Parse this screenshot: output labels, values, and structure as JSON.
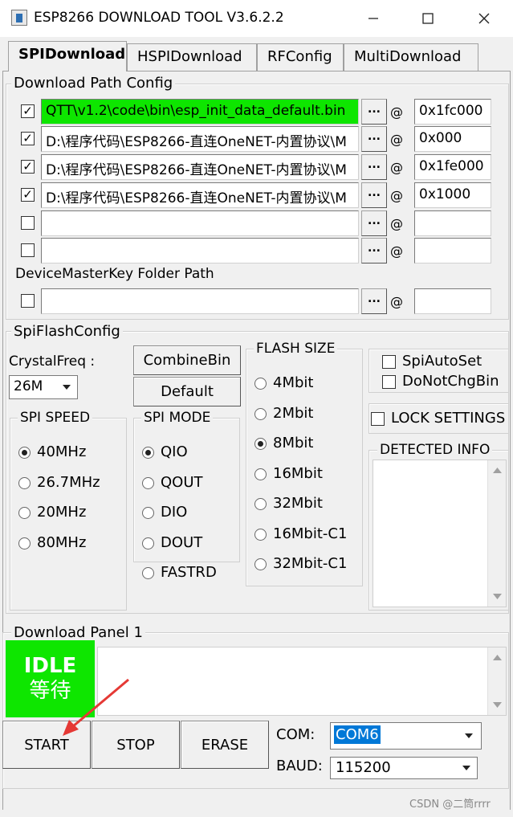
{
  "window": {
    "title": "ESP8266 DOWNLOAD TOOL V3.6.2.2",
    "minimize_icon": "minimize-icon",
    "maximize_icon": "maximize-icon",
    "close_icon": "close-icon"
  },
  "tabs": [
    {
      "label": "SPIDownload",
      "active": true
    },
    {
      "label": "HSPIDownload",
      "active": false
    },
    {
      "label": "RFConfig",
      "active": false
    },
    {
      "label": "MultiDownload",
      "active": false
    }
  ],
  "download_path_config": {
    "title": "Download Path Config",
    "browse_label": "...",
    "at_label": "@",
    "rows": [
      {
        "checked": true,
        "path": "QTT\\v1.2\\code\\bin\\esp_init_data_default.bin",
        "address": "0x1fc000",
        "highlight": "#0ee600"
      },
      {
        "checked": true,
        "path": "D:\\程序代码\\ESP8266-直连OneNET-内置协议\\M",
        "address": "0x000"
      },
      {
        "checked": true,
        "path": "D:\\程序代码\\ESP8266-直连OneNET-内置协议\\M",
        "address": "0x1fe000"
      },
      {
        "checked": true,
        "path": "D:\\程序代码\\ESP8266-直连OneNET-内置协议\\M",
        "address": "0x1000"
      },
      {
        "checked": false,
        "path": "",
        "address": ""
      },
      {
        "checked": false,
        "path": "",
        "address": ""
      }
    ],
    "device_master_key_label": "DeviceMasterKey Folder Path",
    "device_master_key_row": {
      "checked": false,
      "path": "",
      "address": ""
    }
  },
  "spi_flash_config": {
    "title": "SpiFlashConfig",
    "crystal_freq_label": "CrystalFreq :",
    "crystal_freq_value": "26M",
    "combine_bin_label": "CombineBin",
    "default_label": "Default",
    "spi_speed": {
      "title": "SPI SPEED",
      "options": [
        {
          "label": "40MHz",
          "selected": true
        },
        {
          "label": "26.7MHz",
          "selected": false
        },
        {
          "label": "20MHz",
          "selected": false
        },
        {
          "label": "80MHz",
          "selected": false
        }
      ]
    },
    "spi_mode": {
      "title": "SPI MODE",
      "options": [
        {
          "label": "QIO",
          "selected": true
        },
        {
          "label": "QOUT",
          "selected": false
        },
        {
          "label": "DIO",
          "selected": false
        },
        {
          "label": "DOUT",
          "selected": false
        },
        {
          "label": "FASTRD",
          "selected": false
        }
      ]
    },
    "flash_size": {
      "title": "FLASH SIZE",
      "options": [
        {
          "label": "4Mbit",
          "selected": false
        },
        {
          "label": "2Mbit",
          "selected": false
        },
        {
          "label": "8Mbit",
          "selected": true
        },
        {
          "label": "16Mbit",
          "selected": false
        },
        {
          "label": "32Mbit",
          "selected": false
        },
        {
          "label": "16Mbit-C1",
          "selected": false
        },
        {
          "label": "32Mbit-C1",
          "selected": false
        }
      ]
    },
    "spi_auto_set": {
      "label": "SpiAutoSet",
      "checked": false
    },
    "do_not_chg_bin": {
      "label": "DoNotChgBin",
      "checked": false
    },
    "lock_settings": {
      "label": "LOCK SETTINGS",
      "checked": false
    },
    "detected_info_title": "DETECTED INFO"
  },
  "download_panel": {
    "title": "Download Panel 1",
    "status_line1": "IDLE",
    "status_line2": "等待",
    "status_color": "#0ee600",
    "start_label": "START",
    "stop_label": "STOP",
    "erase_label": "ERASE",
    "com_label": "COM:",
    "com_value": "COM6",
    "baud_label": "BAUD:",
    "baud_value": "115200"
  },
  "watermark": "CSDN @二筒rrrr",
  "annotation_arrow_color": "#e53935"
}
